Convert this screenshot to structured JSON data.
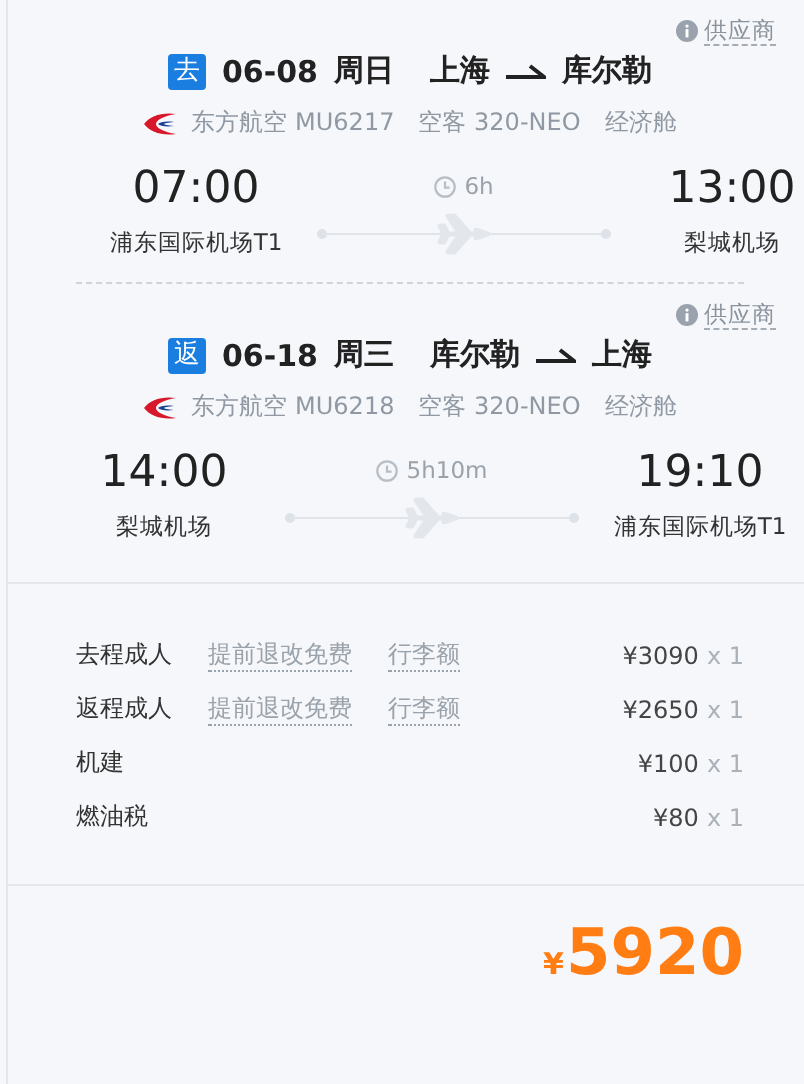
{
  "segments": [
    {
      "direction": "去",
      "date": "06-08",
      "weekday": "周日",
      "from": "上海",
      "to": "库尔勒",
      "supplier": "供应商",
      "airline": "东方航空 MU6217",
      "aircraft": "空客 320-NEO",
      "cabin": "经济舱",
      "depart_time": "07:00",
      "duration": "6h",
      "arrive_time": "13:00",
      "depart_airport": "浦东国际机场T1",
      "arrive_airport": "梨城机场"
    },
    {
      "direction": "返",
      "date": "06-18",
      "weekday": "周三",
      "from": "库尔勒",
      "to": "上海",
      "supplier": "供应商",
      "airline": "东方航空 MU6218",
      "aircraft": "空客 320-NEO",
      "cabin": "经济舱",
      "depart_time": "14:00",
      "duration": "5h10m",
      "arrive_time": "19:10",
      "depart_airport": "梨城机场",
      "arrive_airport": "浦东国际机场T1"
    }
  ],
  "price_rows": [
    {
      "label": "去程成人",
      "links": [
        "提前退改免费",
        "行李额"
      ],
      "amount": "¥3090",
      "quantity": "x 1"
    },
    {
      "label": "返程成人",
      "links": [
        "提前退改免费",
        "行李额"
      ],
      "amount": "¥2650",
      "quantity": "x 1"
    },
    {
      "label": "机建",
      "amount": "¥100",
      "quantity": "x 1"
    },
    {
      "label": "燃油税",
      "amount": "¥80",
      "quantity": "x 1"
    }
  ],
  "total": {
    "currency": "¥",
    "amount": "5920"
  }
}
